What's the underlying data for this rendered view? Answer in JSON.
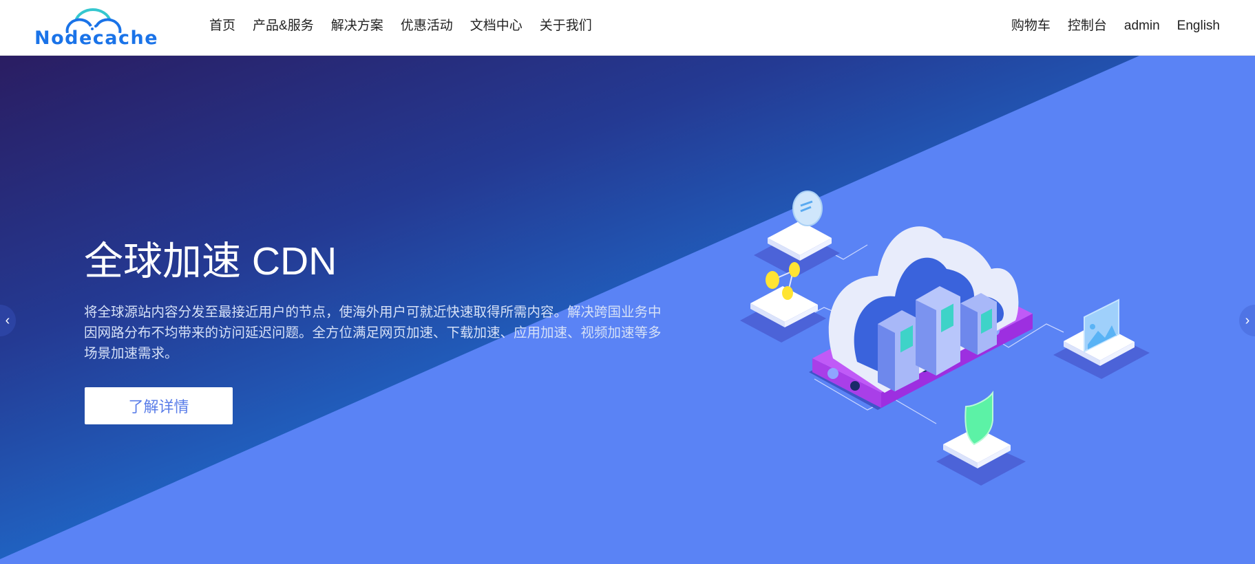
{
  "brand": {
    "name": "Nodecache",
    "logo_icon": "cloud-logo-icon",
    "colors": {
      "primary": "#1a73e8",
      "accent": "#35c7cf"
    }
  },
  "nav": {
    "main": [
      {
        "label": "首页"
      },
      {
        "label": "产品&服务"
      },
      {
        "label": "解决方案"
      },
      {
        "label": "优惠活动"
      },
      {
        "label": "文档中心"
      },
      {
        "label": "关于我们"
      }
    ],
    "right": [
      {
        "label": "购物车"
      },
      {
        "label": "控制台"
      },
      {
        "label": "admin"
      },
      {
        "label": "English"
      }
    ]
  },
  "hero": {
    "title": "全球加速 CDN",
    "description": "将全球源站内容分发至最接近用户的节点，使海外用户可就近快速取得所需内容。解决跨国业务中因网路分布不均带来的访问延迟问题。全方位满足网页加速、下载加速、应用加速、视频加速等多场景加速需求。",
    "button_label": "了解详情",
    "prev_arrow": "‹",
    "next_arrow": "›",
    "illustration": "cloud-servers-network-illustration",
    "colors": {
      "dark": "#2a1d62",
      "bright": "#1e8ae2",
      "flat": "#5a83f5",
      "button_text": "#5a7de8"
    }
  }
}
